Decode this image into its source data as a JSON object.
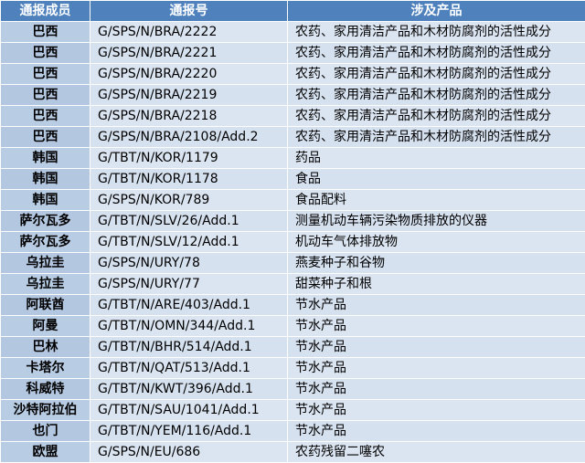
{
  "header": {
    "member": "通报成员",
    "number": "通报号",
    "products": "涉及产品"
  },
  "rows": [
    {
      "member": "巴西",
      "number": "G/SPS/N/BRA/2222",
      "products": "农药、家用清洁产品和木材防腐剂的活性成分"
    },
    {
      "member": "巴西",
      "number": "G/SPS/N/BRA/2221",
      "products": "农药、家用清洁产品和木材防腐剂的活性成分"
    },
    {
      "member": "巴西",
      "number": "G/SPS/N/BRA/2220",
      "products": "农药、家用清洁产品和木材防腐剂的活性成分"
    },
    {
      "member": "巴西",
      "number": "G/SPS/N/BRA/2219",
      "products": "农药、家用清洁产品和木材防腐剂的活性成分"
    },
    {
      "member": "巴西",
      "number": "G/SPS/N/BRA/2218",
      "products": "农药、家用清洁产品和木材防腐剂的活性成分"
    },
    {
      "member": "巴西",
      "number": "G/SPS/N/BRA/2108/Add.2",
      "products": "农药、家用清洁产品和木材防腐剂的活性成分"
    },
    {
      "member": "韩国",
      "number": "G/TBT/N/KOR/1179",
      "products": "药品"
    },
    {
      "member": "韩国",
      "number": "G/TBT/N/KOR/1178",
      "products": "食品"
    },
    {
      "member": "韩国",
      "number": "G/SPS/N/KOR/789",
      "products": "食品配料"
    },
    {
      "member": "萨尔瓦多",
      "number": "G/TBT/N/SLV/26/Add.1",
      "products": "测量机动车辆污染物质排放的仪器"
    },
    {
      "member": "萨尔瓦多",
      "number": "G/TBT/N/SLV/12/Add.1",
      "products": "机动车气体排放物"
    },
    {
      "member": "乌拉圭",
      "number": "G/SPS/N/URY/78",
      "products": "燕麦种子和谷物"
    },
    {
      "member": "乌拉圭",
      "number": "G/SPS/N/URY/77",
      "products": "甜菜种子和根"
    },
    {
      "member": "阿联酋",
      "number": "G/TBT/N/ARE/403/Add.1",
      "products": "节水产品"
    },
    {
      "member": "阿曼",
      "number": "G/TBT/N/OMN/344/Add.1",
      "products": "节水产品"
    },
    {
      "member": "巴林",
      "number": "G/TBT/N/BHR/514/Add.1",
      "products": "节水产品"
    },
    {
      "member": "卡塔尔",
      "number": "G/TBT/N/QAT/513/Add.1",
      "products": "节水产品"
    },
    {
      "member": "科威特",
      "number": "G/TBT/N/KWT/396/Add.1",
      "products": "节水产品"
    },
    {
      "member": "沙特阿拉伯",
      "number": "G/TBT/N/SAU/1041/Add.1",
      "products": "节水产品"
    },
    {
      "member": "也门",
      "number": "G/TBT/N/YEM/116/Add.1",
      "products": "节水产品"
    },
    {
      "member": "欧盟",
      "number": "G/SPS/N/EU/686",
      "products": "农药残留二噻农"
    }
  ]
}
